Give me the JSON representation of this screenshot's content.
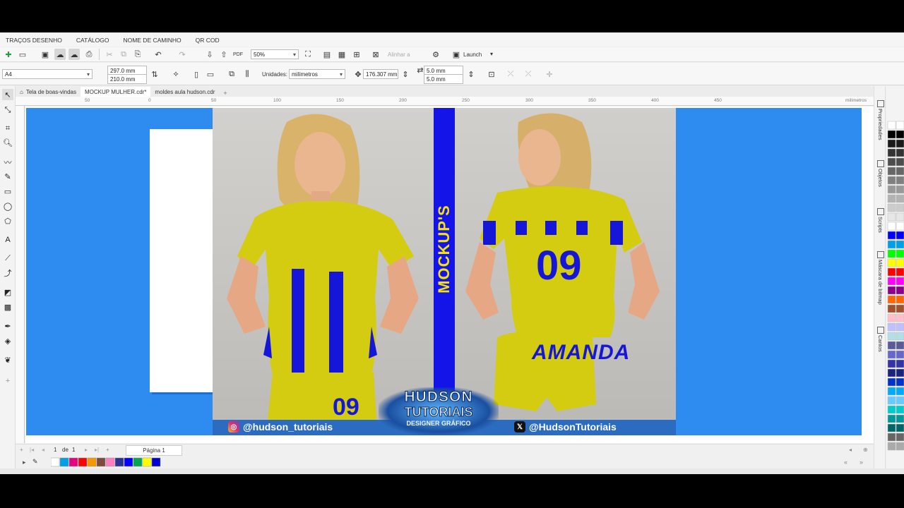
{
  "menu": [
    "TRAÇOS DESENHO",
    "CATÁLOGO",
    "NOME DE CAMINHO",
    "QR COD"
  ],
  "toolbar": {
    "zoom": "50%",
    "align_label": "Alinhar a",
    "launch": "Launch"
  },
  "propbar": {
    "page_size": "A4",
    "width": "297.0 mm",
    "height": "210.0 mm",
    "units_label": "Unidades:",
    "units": "milímetros",
    "nudge": "176.307 mm",
    "dup_x": "5.0 mm",
    "dup_y": "5.0 mm"
  },
  "tabs": [
    "Tela de boas-vindas",
    "MOCKUP MULHER.cdr*",
    "moldes aula hudson.cdr"
  ],
  "ruler": {
    "labels": [
      "50",
      "0",
      "50",
      "100",
      "150",
      "200",
      "250",
      "300",
      "350",
      "400",
      "450"
    ],
    "unit": "milímetros"
  },
  "mockup": {
    "stripe_text": "MOCKUP'S",
    "front_number": "09",
    "back_number": "09",
    "back_name": "AMANDA",
    "logo_line1": "HUDSON",
    "logo_line2": "TUTORIAIS",
    "logo_line3": "DESIGNER GRÁFICO",
    "instagram": "@hudson_tutoriais",
    "twitter": "@HudsonTutoriais"
  },
  "dockers": [
    "Propriedades",
    "Objetos",
    "Scripts",
    "Máscara de bitmap",
    "Cantos"
  ],
  "pagebar": {
    "page_current": "1",
    "page_of": "de",
    "page_total": "1",
    "page_tab": "Página 1"
  },
  "colors": {
    "canvas_blue": "#2e8cf0",
    "jersey_yellow": "#d4cc10",
    "jersey_blue": "#1616d8",
    "stripe_blue": "#1414e8"
  }
}
